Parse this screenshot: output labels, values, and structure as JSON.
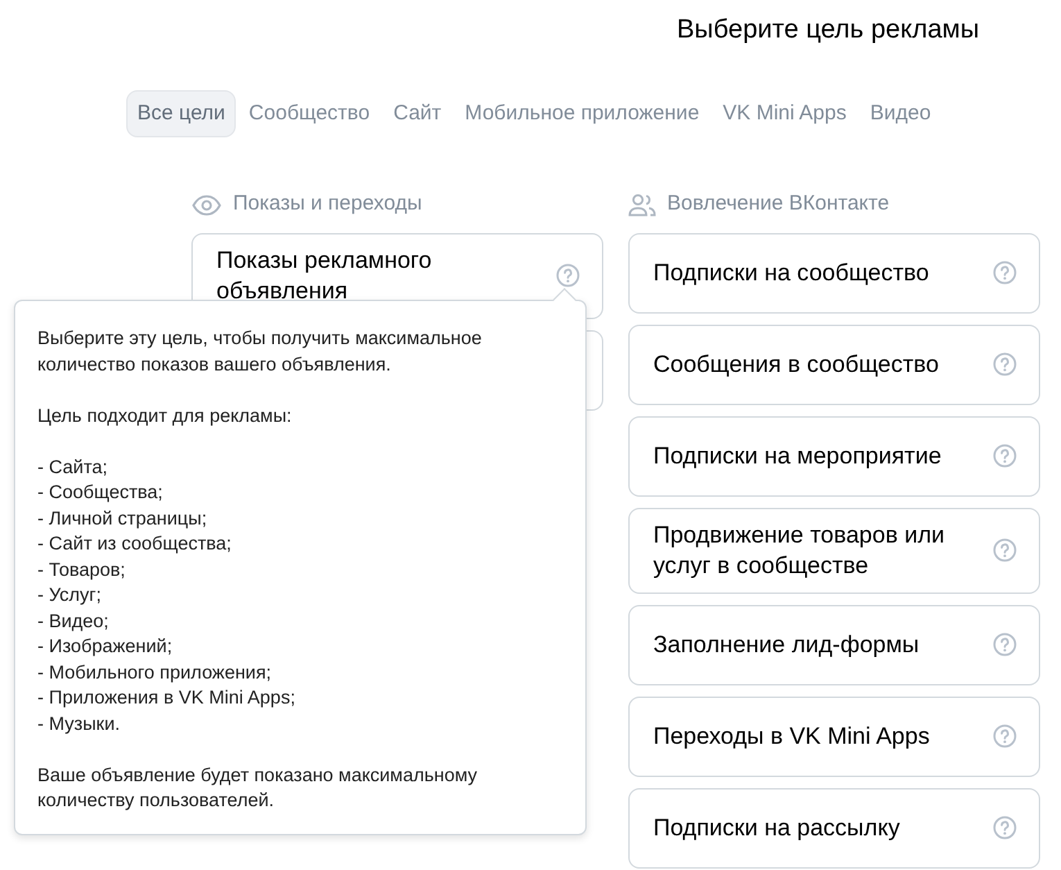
{
  "title": "Выберите цель рекламы",
  "tabs": [
    {
      "label": "Все цели",
      "selected": true
    },
    {
      "label": "Сообщество",
      "selected": false
    },
    {
      "label": "Сайт",
      "selected": false
    },
    {
      "label": "Мобильное приложение",
      "selected": false
    },
    {
      "label": "VK Mini Apps",
      "selected": false
    },
    {
      "label": "Видео",
      "selected": false
    }
  ],
  "sections": [
    {
      "heading": "Показы и переходы",
      "goals": [
        {
          "label": "Показы рекламного объявления",
          "kind": "goal"
        },
        {
          "kind": "hidden"
        }
      ]
    },
    {
      "heading": "Вовлечение ВКонтакте",
      "goals": [
        {
          "label": "Подписки на сообщество",
          "kind": "goal"
        },
        {
          "label": "Сообщения в сообщество",
          "kind": "goal"
        },
        {
          "label": "Подписки на мероприятие",
          "kind": "goal"
        },
        {
          "label": "Продвижение товаров или услуг в сообществе",
          "kind": "goal"
        },
        {
          "label": "Заполнение лид-формы",
          "kind": "goal"
        },
        {
          "label": "Переходы в VK Mini Apps",
          "kind": "goal"
        },
        {
          "label": "Подписки на рассылку",
          "kind": "goal"
        }
      ]
    }
  ],
  "tooltip": {
    "intro": "Выберите эту цель, чтобы получить максимальное количество показов вашего объявления.",
    "heading": "Цель подходит для рекламы:",
    "items": [
      "- Сайта;",
      "- Сообщества;",
      "- Личной страницы;",
      "- Сайт из сообщества;",
      "- Товаров;",
      "- Услуг;",
      "- Видео;",
      "- Изображений;",
      "- Мобильного приложения;",
      "- Приложения в VK Mini Apps;",
      "- Музыки."
    ],
    "outro": "Ваше объявление будет показано максимальному количеству пользователей."
  }
}
